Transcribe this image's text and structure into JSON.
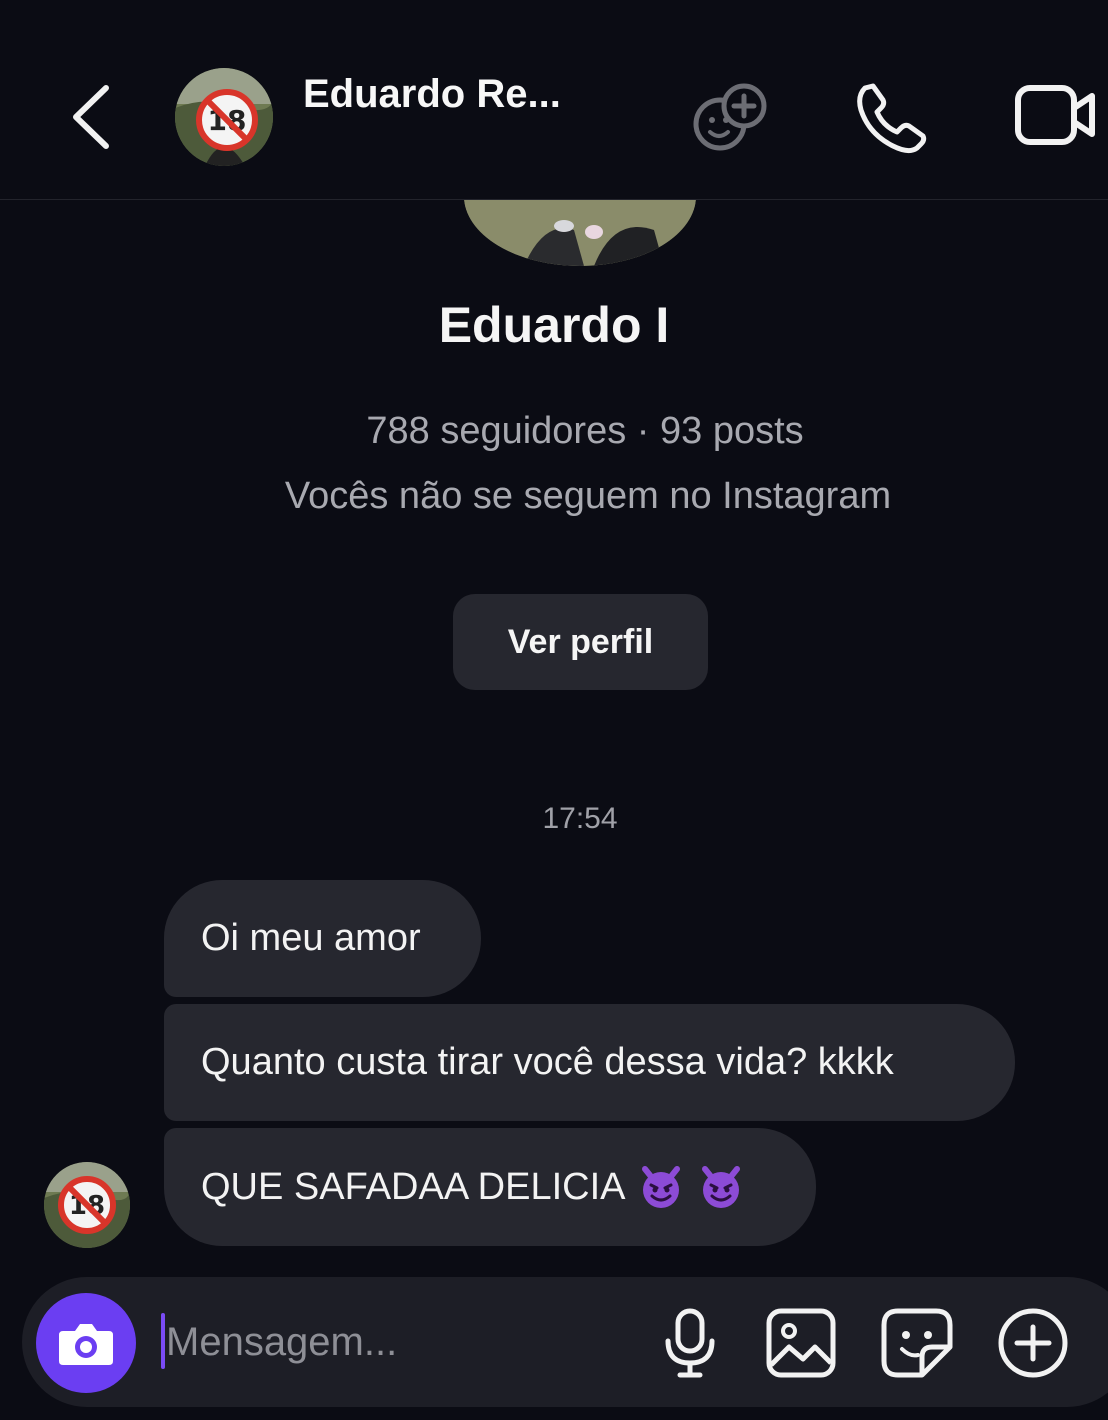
{
  "header": {
    "contact_name": "Eduardo Re...",
    "icons": [
      "back-arrow-icon",
      "avatar",
      "effects-icon",
      "phone-icon",
      "video-camera-icon"
    ]
  },
  "profile": {
    "name": "Eduardo I",
    "stats": "788 seguidores · 93 posts",
    "follow_status": "Vocês não se seguem no Instagram",
    "view_profile_label": "Ver perfil"
  },
  "chat": {
    "timestamp": "17:54",
    "messages": [
      {
        "text": "Oi meu amor"
      },
      {
        "text": "Quanto custa tirar você dessa vida? kkkk"
      },
      {
        "text": "QUE SAFADAA DELICIA",
        "emojis": [
          "smiling-devil-emoji",
          "smiling-devil-emoji"
        ]
      }
    ]
  },
  "composer": {
    "placeholder": "Mensagem...",
    "icons": [
      "camera-icon",
      "microphone-icon",
      "gallery-icon",
      "sticker-icon",
      "plus-icon"
    ]
  },
  "colors": {
    "background": "#0b0c14",
    "bubble": "#26272f",
    "accent": "#6b3ef2",
    "secondary_text": "#a8a9b0"
  }
}
